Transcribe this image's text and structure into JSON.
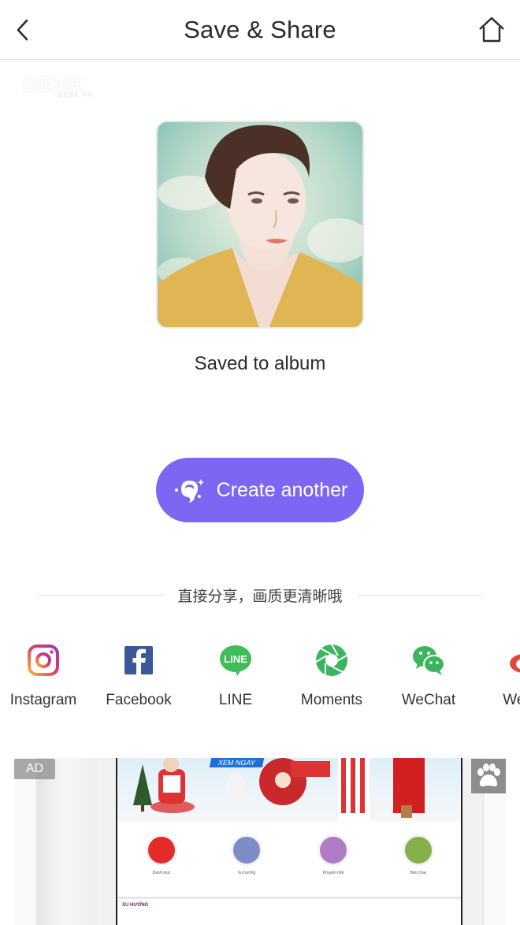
{
  "nav": {
    "title": "Save & Share",
    "back_icon": "chevron-left-icon",
    "home_icon": "home-icon"
  },
  "watermark": {
    "brand": "GENK",
    "sub": "GENK.VN"
  },
  "result": {
    "status": "Saved to album"
  },
  "create_button": {
    "label": "Create another",
    "icon": "sparkle-face-icon",
    "color": "#7d66f2"
  },
  "share": {
    "heading": "直接分享，画质更清晰哦",
    "items": [
      {
        "label": "Instagram",
        "icon": "instagram-icon"
      },
      {
        "label": "Facebook",
        "icon": "facebook-icon",
        "color": "#3b5998"
      },
      {
        "label": "LINE",
        "icon": "line-icon",
        "color": "#3ebe58"
      },
      {
        "label": "Moments",
        "icon": "moments-icon",
        "color": "#3cb55f"
      },
      {
        "label": "WeChat",
        "icon": "wechat-icon",
        "color": "#3cb55f"
      },
      {
        "label": "Weibo",
        "icon": "weibo-icon",
        "color": "#e6463a"
      }
    ]
  },
  "ad": {
    "badge": "AD",
    "banner_cta": "XEM NGAY",
    "categories": [
      {
        "label": "Danh mục",
        "color": "#e52a2a"
      },
      {
        "label": "Xu hướng",
        "color": "#7b8cc8"
      },
      {
        "label": "Khuyến mãi",
        "color": "#b07cc6"
      },
      {
        "label": "Bán chạy",
        "color": "#86b04a"
      }
    ],
    "section_title": "XU HƯỚNG",
    "corner_icon": "paw-icon"
  }
}
